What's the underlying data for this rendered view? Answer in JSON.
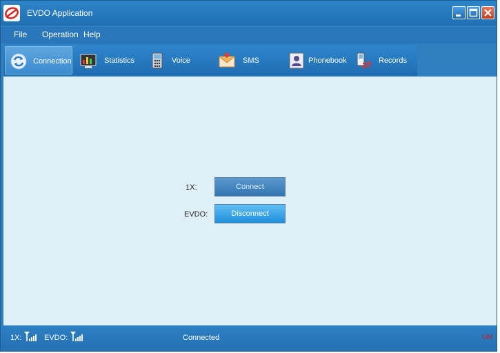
{
  "window": {
    "title": "EVDO Application"
  },
  "menu": {
    "items": [
      "File",
      "Operation",
      "Help"
    ]
  },
  "tabs": [
    {
      "label": "Connection",
      "icon": "connection-icon",
      "active": true
    },
    {
      "label": "Statistics",
      "icon": "statistics-icon",
      "active": false
    },
    {
      "label": "Voice",
      "icon": "phone-icon",
      "active": false
    },
    {
      "label": "SMS",
      "icon": "envelope-icon",
      "active": false
    },
    {
      "label": "Phonebook",
      "icon": "contact-card-icon",
      "active": false
    },
    {
      "label": "Records",
      "icon": "records-icon",
      "active": false
    }
  ],
  "connection": {
    "label_1x": "1X:",
    "label_evdo": "EVDO:",
    "connect_label": "Connect",
    "disconnect_label": "Disconnect"
  },
  "status": {
    "label_1x": "1X:",
    "label_evdo": "EVDO:",
    "state": "Connected",
    "indicator": "UM"
  },
  "colors": {
    "accent": "#2f7fc0",
    "content_bg": "#dff0f9",
    "indicator": "#c81d1d"
  }
}
